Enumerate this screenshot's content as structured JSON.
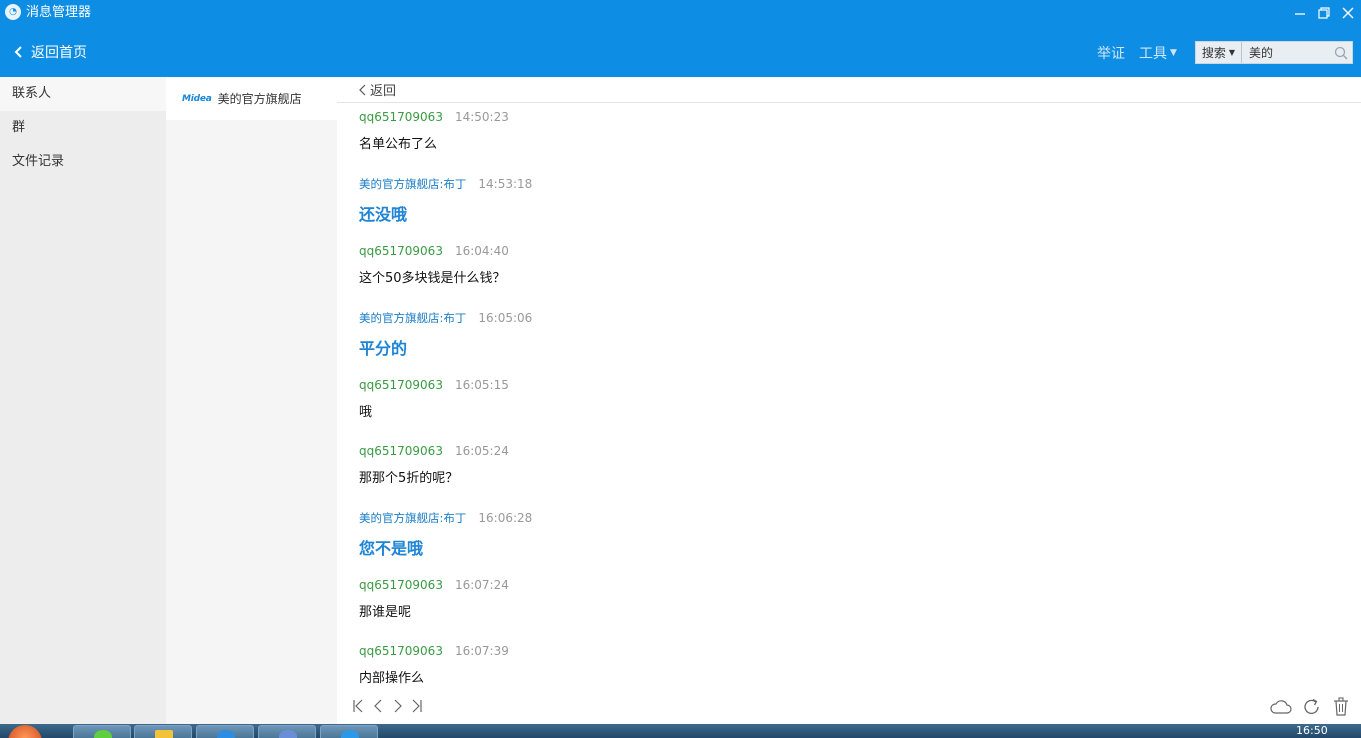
{
  "app": {
    "title": "消息管理器"
  },
  "nav": {
    "back_home": "返回首页",
    "report": "举证",
    "tools": "工具",
    "search_scope": "搜索",
    "search_value": "美的"
  },
  "sidebar": {
    "items": [
      {
        "label": "联系人",
        "active": true
      },
      {
        "label": "群",
        "active": false
      },
      {
        "label": "文件记录",
        "active": false
      }
    ]
  },
  "contacts": [
    {
      "logo_text": "Midea",
      "name": "美的官方旗舰店"
    }
  ],
  "conversation": {
    "back_label": "返回",
    "messages": [
      {
        "sender": "qq651709063",
        "time": "14:50:23",
        "text": "名单公布了么",
        "from": "customer"
      },
      {
        "sender": "美的官方旗舰店:布丁",
        "time": "14:53:18",
        "text": "还没哦",
        "from": "store"
      },
      {
        "sender": "qq651709063",
        "time": "16:04:40",
        "text": "这个50多块钱是什么钱？",
        "from": "customer"
      },
      {
        "sender": "美的官方旗舰店:布丁",
        "time": "16:05:06",
        "text": "平分的",
        "from": "store"
      },
      {
        "sender": "qq651709063",
        "time": "16:05:15",
        "text": "哦",
        "from": "customer"
      },
      {
        "sender": "qq651709063",
        "time": "16:05:24",
        "text": "那那个5折的呢？",
        "from": "customer"
      },
      {
        "sender": "美的官方旗舰店:布丁",
        "time": "16:06:28",
        "text": "您不是哦",
        "from": "store"
      },
      {
        "sender": "qq651709063",
        "time": "16:07:24",
        "text": "那谁是呢",
        "from": "customer"
      },
      {
        "sender": "qq651709063",
        "time": "16:07:39",
        "text": "内部操作么",
        "from": "customer"
      }
    ]
  },
  "footer": {
    "pager_icons": [
      "first-page-icon",
      "prev-page-icon",
      "next-page-icon",
      "last-page-icon"
    ],
    "tool_icons": [
      "cloud-icon",
      "refresh-icon",
      "trash-icon"
    ]
  },
  "taskbar": {
    "clock": "16:50"
  },
  "colors": {
    "brand_blue": "#0d8de3",
    "customer_name": "#3a9a42",
    "store_name": "#1b7dc5",
    "store_reply": "#1d84d6"
  }
}
